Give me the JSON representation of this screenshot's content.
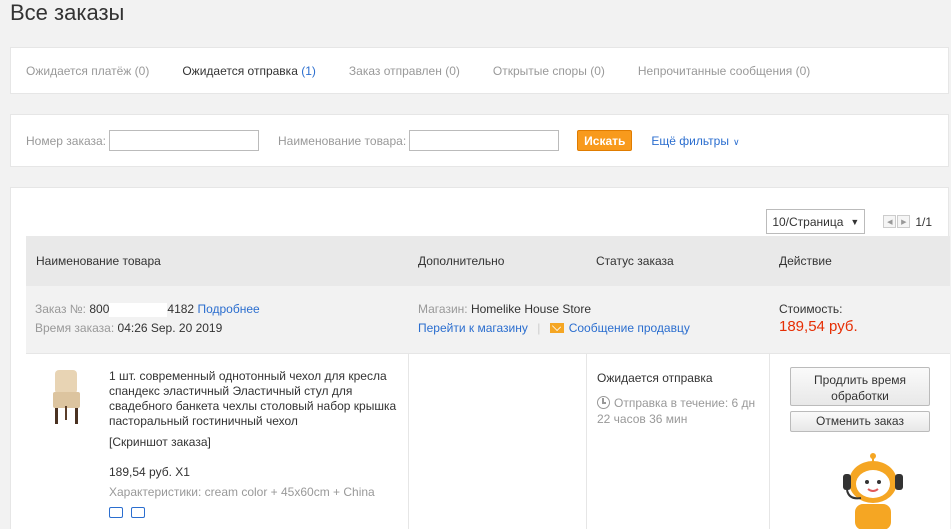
{
  "page": {
    "title": "Все заказы"
  },
  "tabs": [
    {
      "label": "Ожидается платёж",
      "count": "(0)",
      "active": false
    },
    {
      "label": "Ожидается отправка",
      "count": "(1)",
      "active": true
    },
    {
      "label": "Заказ отправлен",
      "count": "(0)",
      "active": false
    },
    {
      "label": "Открытые споры",
      "count": "(0)",
      "active": false
    },
    {
      "label": "Непрочитанные сообщения",
      "count": "(0)",
      "active": false
    }
  ],
  "filters": {
    "order_number_label": "Номер заказа:",
    "order_number_value": "",
    "product_name_label": "Наименование товара:",
    "product_name_value": "",
    "search_button": "Искать",
    "more_filters": "Ещё фильтры"
  },
  "pagination": {
    "per_page": "10/Страница",
    "page_count": "1/1"
  },
  "table_header": {
    "product": "Наименование товара",
    "additional": "Дополнительно",
    "status": "Статус заказа",
    "action": "Действие"
  },
  "order": {
    "number_label": "Заказ №:",
    "number_prefix": "800",
    "number_suffix": "4182",
    "details_link": "Подробнее",
    "time_label": "Время заказа:",
    "time_value": "04:26 Sep. 20 2019",
    "store_label": "Магазин:",
    "store_name": "Homelike House Store",
    "go_to_store": "Перейти к магазину",
    "separator": "|",
    "message_seller": "Сообщение продавцу",
    "cost_label": "Стоимость:",
    "cost_value": "189,54 руб.",
    "item": {
      "title": "1 шт. современный однотонный чехол для кресла спандекс эластичный Эластичный стул для свадебного банкета чехлы столовый набор крышка пасторальный гостиничный чехол",
      "snapshot": "[Скриншот заказа]",
      "price_qty": "189,54 руб. X1",
      "properties": "Характеристики: cream color + 45x60cm + China"
    },
    "status": "Ожидается отправка",
    "timer": "Отправка в течение: 6 дн 22 часов 36 мин",
    "extend_button": "Продлить время обработки",
    "cancel_button": "Отменить заказ"
  },
  "colors": {
    "accent": "#f89a1c",
    "link": "#2b6ecf",
    "price": "#e62e04",
    "robot": "#f5a623"
  }
}
